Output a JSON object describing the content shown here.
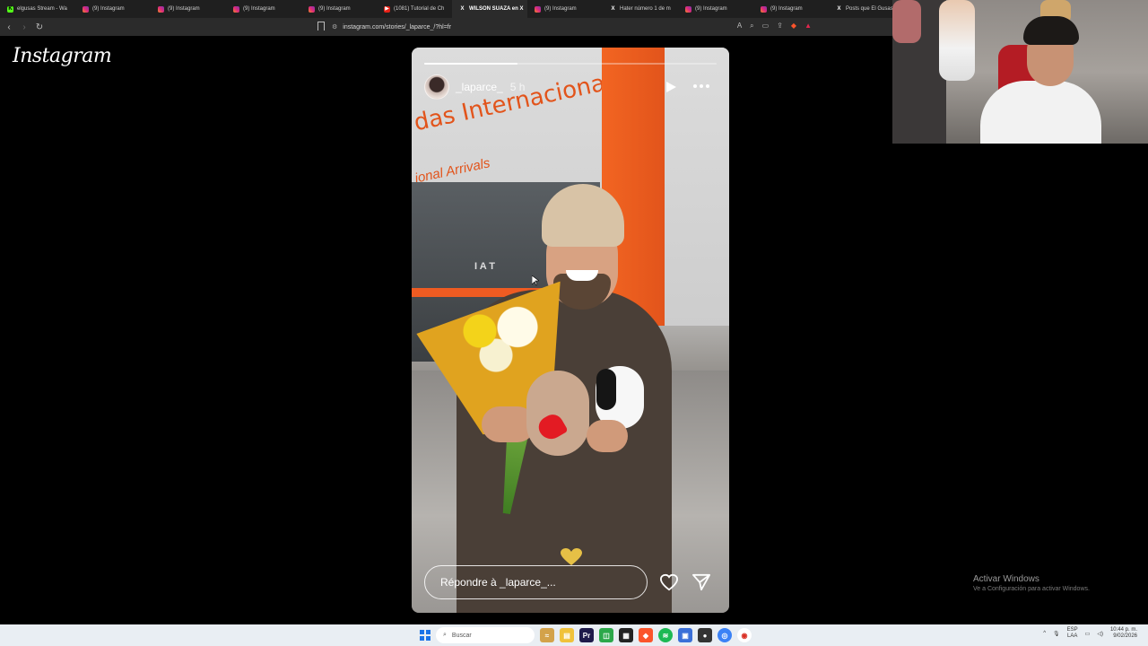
{
  "browser": {
    "tabs": [
      {
        "label": "elgusas Stream - Wa",
        "icon": "kick-icon",
        "active": false
      },
      {
        "label": "(9) Instagram",
        "icon": "instagram-icon",
        "active": false
      },
      {
        "label": "(9) Instagram",
        "icon": "instagram-icon",
        "active": false
      },
      {
        "label": "(9) Instagram",
        "icon": "instagram-icon",
        "active": false
      },
      {
        "label": "(9) Instagram",
        "icon": "instagram-icon",
        "active": false
      },
      {
        "label": "(1081) Tutorial de Ch",
        "icon": "youtube-icon",
        "active": false
      },
      {
        "label": "WILSON SUAZA en X",
        "icon": "x-icon",
        "active": true
      },
      {
        "label": "(9) Instagram",
        "icon": "instagram-icon",
        "active": false
      },
      {
        "label": "Hater número 1 de m",
        "icon": "x-icon",
        "active": false
      },
      {
        "label": "(9) Instagram",
        "icon": "instagram-icon",
        "active": false
      },
      {
        "label": "(9) Instagram",
        "icon": "instagram-icon",
        "active": false
      },
      {
        "label": "Posts que El Gusas",
        "icon": "x-icon",
        "active": false
      }
    ],
    "url": "instagram.com/stories/_laparce_/?hl=fr"
  },
  "instagram": {
    "logo_text": "Instagram",
    "story": {
      "username": "_laparce_",
      "time": "5 h",
      "progress": 0.32,
      "reply_placeholder": "Répondre à _laparce_...",
      "sign_text_line1": "das Internacionales",
      "sign_text_line2": "ional Arrivals",
      "door_text": "I A T"
    }
  },
  "overlay": {
    "activate_title": "Activar Windows",
    "activate_sub": "Ve a Configuración para activar Windows."
  },
  "taskbar": {
    "search_label": "Buscar",
    "lang_line1": "ESP",
    "lang_line2": "LAA",
    "time": "10:44 p. m.",
    "date": "9/02/2026"
  },
  "colors": {
    "ig_gradient_start": "#f58529",
    "ig_gradient_end": "#8134af",
    "story_orange": "#e2541b",
    "windows_blue": "#1b73e8"
  }
}
